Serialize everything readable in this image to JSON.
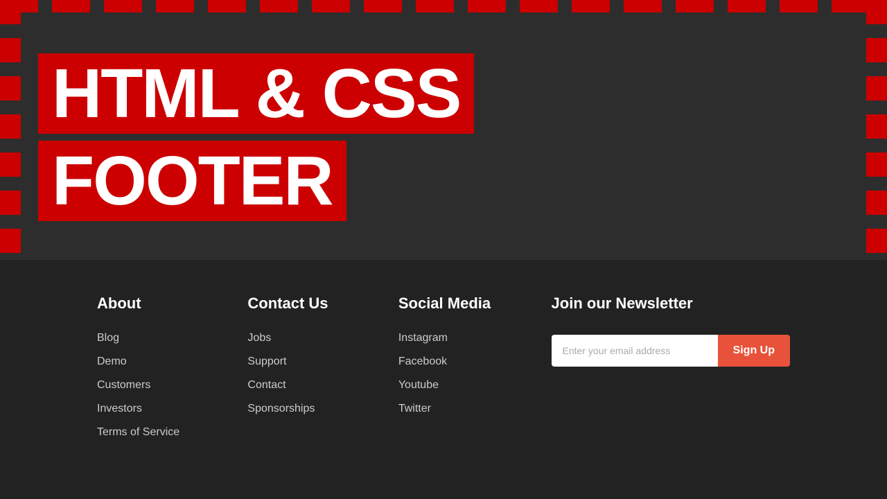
{
  "hero": {
    "title_line1": "HTML & CSS",
    "title_line2": "FOOTER"
  },
  "footer": {
    "about": {
      "heading": "About",
      "links": [
        {
          "label": "Blog"
        },
        {
          "label": "Demo"
        },
        {
          "label": "Customers"
        },
        {
          "label": "Investors"
        },
        {
          "label": "Terms of Service"
        }
      ]
    },
    "contact": {
      "heading": "Contact Us",
      "links": [
        {
          "label": "Jobs"
        },
        {
          "label": "Support"
        },
        {
          "label": "Contact"
        },
        {
          "label": "Sponsorships"
        }
      ]
    },
    "social": {
      "heading": "Social Media",
      "links": [
        {
          "label": "Instagram"
        },
        {
          "label": "Facebook"
        },
        {
          "label": "Youtube"
        },
        {
          "label": "Twitter"
        }
      ]
    },
    "newsletter": {
      "heading": "Join our Newsletter",
      "input_placeholder": "Enter your email address",
      "button_label": "Sign Up"
    }
  }
}
